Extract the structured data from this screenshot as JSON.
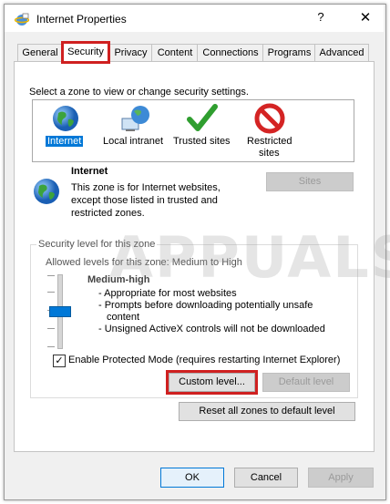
{
  "window": {
    "title": "Internet Properties",
    "help": "?",
    "close": "✕"
  },
  "tabs": [
    {
      "label": "General"
    },
    {
      "label": "Security"
    },
    {
      "label": "Privacy"
    },
    {
      "label": "Content"
    },
    {
      "label": "Connections"
    },
    {
      "label": "Programs"
    },
    {
      "label": "Advanced"
    }
  ],
  "active_tab": "Security",
  "security": {
    "instruction": "Select a zone to view or change security settings.",
    "zones": [
      {
        "label": "Internet",
        "icon": "globe-icon",
        "selected": true
      },
      {
        "label": "Local intranet",
        "icon": "intranet-icon",
        "selected": false
      },
      {
        "label": "Trusted sites",
        "icon": "checkmark-icon",
        "selected": false
      },
      {
        "label": "Restricted",
        "label2": "sites",
        "icon": "no-entry-icon",
        "selected": false
      }
    ],
    "zone_title": "Internet",
    "zone_desc": [
      "This zone is for Internet websites,",
      "except those listed in trusted and",
      "restricted zones."
    ],
    "sites_button": "Sites",
    "level_group_title": "Security level for this zone",
    "allowed_levels": "Allowed levels for this zone: Medium to High",
    "level_name": "Medium-high",
    "level_points": [
      "- Appropriate for most websites",
      "- Prompts before downloading potentially unsafe",
      "content",
      "- Unsigned ActiveX controls will not be downloaded"
    ],
    "slider_level": 0.5,
    "protected_mode_label": "Enable Protected Mode (requires restarting Internet Explorer)",
    "protected_mode_checked": true,
    "checkmark": "✓",
    "custom_level_button": "Custom level...",
    "default_level_button": "Default level",
    "reset_all_button": "Reset all zones to default level"
  },
  "footer": {
    "ok": "OK",
    "cancel": "Cancel",
    "apply": "Apply"
  },
  "watermark": "APPUALS",
  "colors": {
    "highlight": "#cf2020",
    "selection": "#0078d7",
    "window_bg": "#f0f0f0"
  }
}
